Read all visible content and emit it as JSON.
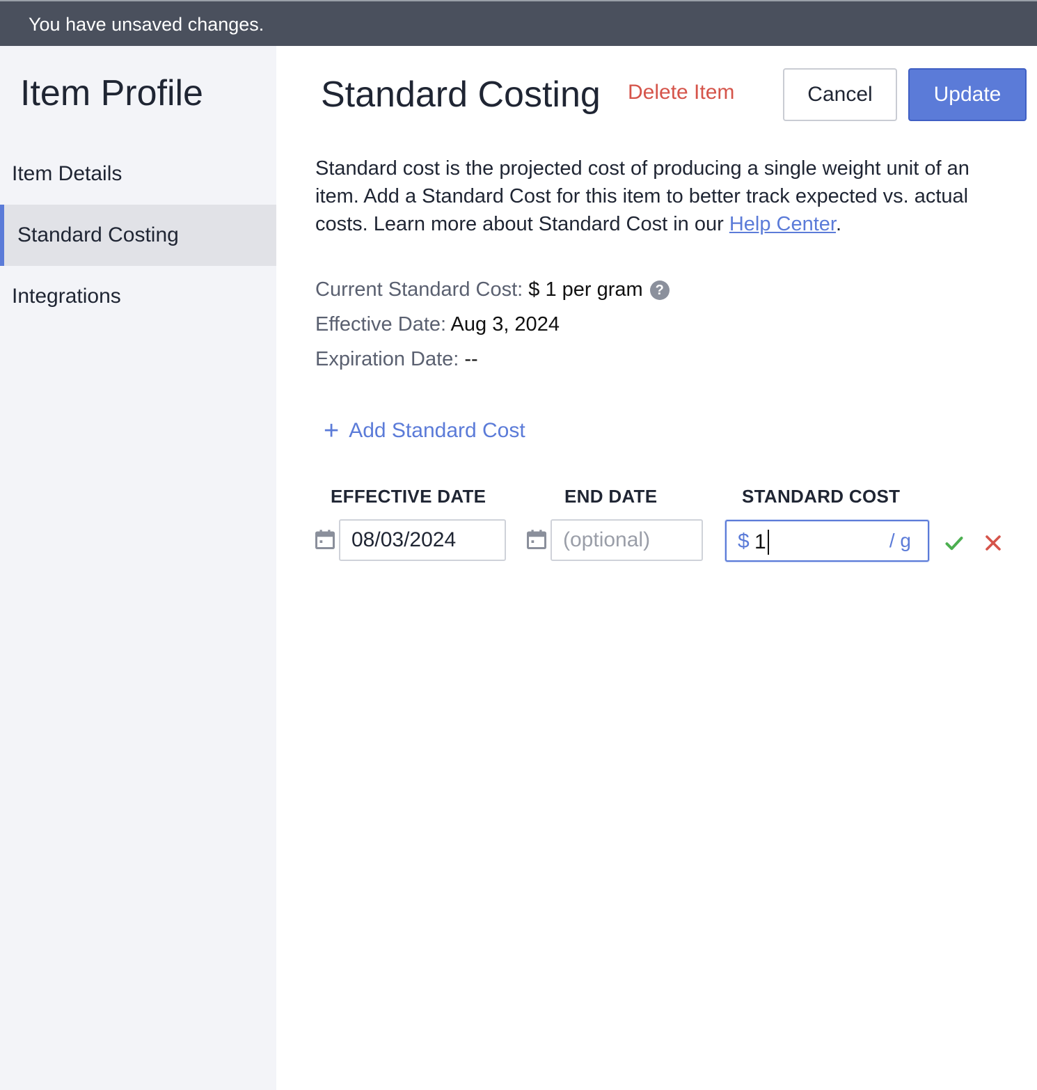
{
  "banner": {
    "text": "You have unsaved changes."
  },
  "sidebar": {
    "title": "Item Profile",
    "items": [
      {
        "label": "Item Details",
        "active": false
      },
      {
        "label": "Standard Costing",
        "active": true
      },
      {
        "label": "Integrations",
        "active": false
      }
    ]
  },
  "main": {
    "title": "Standard Costing",
    "delete_label": "Delete Item",
    "cancel_label": "Cancel",
    "update_label": "Update",
    "description_text": "Standard cost is the projected cost of producing a single weight unit of an item. Add a Standard Cost for this item to better track expected vs. actual costs. Learn more about Standard Cost in our ",
    "help_link": "Help Center",
    "description_end": ".",
    "current_cost_label": "Current Standard Cost:",
    "current_cost_value": "$ 1 per gram",
    "effective_date_label": "Effective Date:",
    "effective_date_value": "Aug 3, 2024",
    "expiration_date_label": "Expiration Date:",
    "expiration_date_value": "--",
    "add_link": "Add Standard Cost",
    "columns": {
      "effective": "EFFECTIVE DATE",
      "end": "END DATE",
      "cost": "STANDARD COST"
    },
    "row": {
      "effective_value": "08/03/2024",
      "end_placeholder": "(optional)",
      "currency": "$",
      "cost_value": "1",
      "unit": "/ g"
    }
  },
  "colors": {
    "accent": "#5b7bd8",
    "danger": "#d5544a",
    "success": "#4caf50",
    "banner": "#4a505d"
  },
  "icons": [
    "help-icon",
    "plus-icon",
    "calendar-icon",
    "check-icon",
    "close-icon"
  ]
}
